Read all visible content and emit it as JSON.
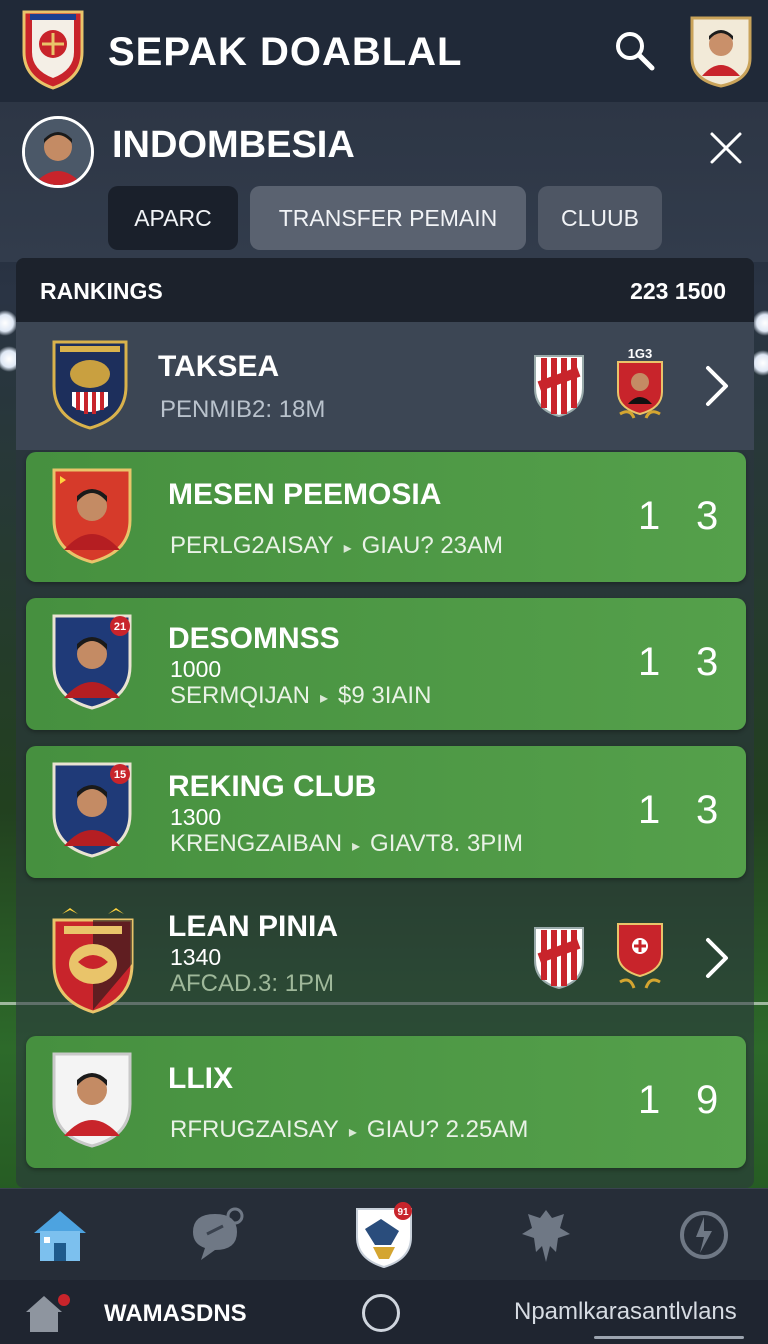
{
  "header": {
    "app_title": "SEPAK DOABLAL"
  },
  "country": {
    "title": "INDOMBESIA",
    "tabs": [
      {
        "label": "APARC",
        "active": true
      },
      {
        "label": "TRANSFER PEMAIN",
        "active": false
      },
      {
        "label": "CLUUB",
        "active": false
      }
    ]
  },
  "rankings": {
    "title": "RANKINGS",
    "count": "223 1500",
    "rows": [
      {
        "name": "TAKSEA",
        "detail": "PENMIB2: 18M",
        "score_a": "",
        "score_b": ""
      },
      {
        "name": "MESEN PEEMOSIA",
        "detail_left": "PERLG2AISAY",
        "detail_right": "GIAU? 23AM",
        "score_a": "1",
        "score_b": "3"
      },
      {
        "name": "DESOMNSS",
        "sub": "1000",
        "detail_left": "SERMQIJAN",
        "detail_right": "$9 3IAIN",
        "score_a": "1",
        "score_b": "3",
        "badge_num": "21"
      },
      {
        "name": "REKING CLUB",
        "sub": "1300",
        "detail_left": "KRENGZAIBAN",
        "detail_right": "GIAVT8. 3PIM",
        "score_a": "1",
        "score_b": "3",
        "badge_num": "15"
      },
      {
        "name": "LEAN PINIA",
        "sub": "1340",
        "detail": "AFCAD.3: 1PM"
      },
      {
        "name": "LLIX",
        "detail_left": "RFRUGZAISAY",
        "detail_right": "GIAU? 2.25AM",
        "score_a": "1",
        "score_b": "9"
      }
    ],
    "shield_label": "1G3"
  },
  "bottom_nav": {
    "items": [
      "home",
      "chat",
      "club",
      "eagle",
      "history"
    ],
    "club_badge": "91"
  },
  "system_bar": {
    "left_label": "WAMASDNS",
    "right_label": "Npamlkarasantlvlans"
  },
  "colors": {
    "row_green": "#4f9a45",
    "row_dark": "#3c4654",
    "topbar": "#202938"
  }
}
